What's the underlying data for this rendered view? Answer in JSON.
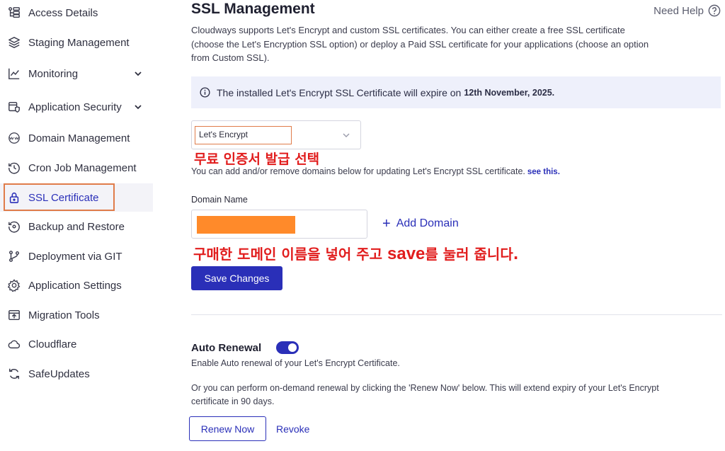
{
  "sidebar": {
    "items": [
      {
        "label": "Access Details",
        "icon": "access-details-icon"
      },
      {
        "label": "Staging Management",
        "icon": "layers-icon"
      },
      {
        "label": "Monitoring",
        "icon": "line-chart-icon",
        "expandable": true
      },
      {
        "label": "Application Security",
        "icon": "security-icon",
        "expandable": true
      },
      {
        "label": "Domain Management",
        "icon": "www-icon"
      },
      {
        "label": "Cron Job Management",
        "icon": "clock-history-icon"
      },
      {
        "label": "SSL Certificate",
        "icon": "lock-icon",
        "active": true
      },
      {
        "label": "Backup and Restore",
        "icon": "backup-icon"
      },
      {
        "label": "Deployment via GIT",
        "icon": "git-branch-icon"
      },
      {
        "label": "Application Settings",
        "icon": "gear-icon"
      },
      {
        "label": "Migration Tools",
        "icon": "migration-icon"
      },
      {
        "label": "Cloudflare",
        "icon": "cloud-icon"
      },
      {
        "label": "SafeUpdates",
        "icon": "refresh-icon"
      }
    ]
  },
  "main": {
    "title": "SSL Management",
    "help_label": "Need Help",
    "intro": "Cloudways supports Let's Encrypt and custom SSL certificates. You can either create a free SSL certificate (choose the Let's Encryption SSL option) or deploy a Paid SSL certificate for your applications (choose an option from Custom SSL).",
    "banner": {
      "text": "The installed Let's Encrypt SSL Certificate will expire on",
      "date": "12th November, 2025."
    },
    "ssl_type": {
      "selected": "Let's Encrypt"
    },
    "annotation_1": "무료 인증서 발급 선택",
    "helper_text": "You can add and/or remove domains below for updating Let's Encrypt SSL certificate.",
    "helper_link": "see this.",
    "domain_label": "Domain Name",
    "add_domain_label": "Add Domain",
    "annotation_2_pre": "구매한 도메인 이름을 넣어 주고 ",
    "annotation_2_mid": "save",
    "annotation_2_post": "를 눌러 줍니다.",
    "save_button": "Save Changes",
    "auto_renewal": {
      "title": "Auto Renewal",
      "enabled": true,
      "description": "Enable Auto renewal of your Let's Encrypt Certificate.",
      "ondemand": "Or you can perform on-demand renewal by clicking the 'Renew Now' below. This will extend expiry of your Let's Encrypt certificate in 90 days.",
      "renew_button": "Renew Now",
      "revoke_label": "Revoke"
    }
  },
  "colors": {
    "accent": "#2a2fb8",
    "highlight_box": "#e07c4a",
    "annotation": "#e11d1d",
    "banner_bg": "#eef0fb",
    "redaction": "#ff8a2a"
  }
}
